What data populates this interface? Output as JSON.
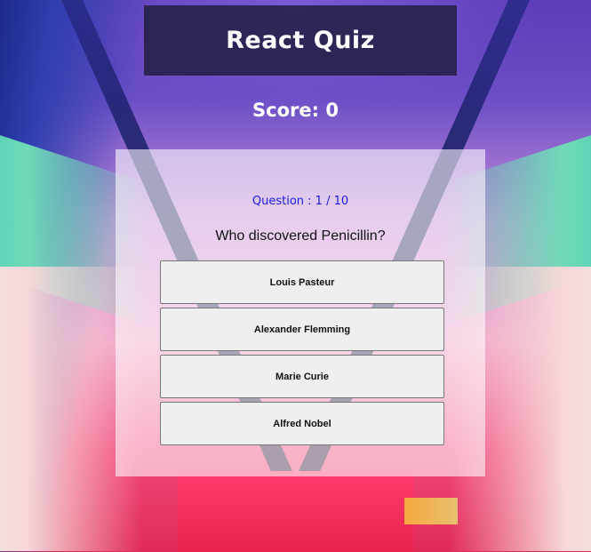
{
  "header": {
    "title": "React Quiz"
  },
  "score": {
    "label": "Score: 0"
  },
  "quiz": {
    "counter": "Question : 1 / 10",
    "question": "Who discovered Penicillin?",
    "answers": [
      {
        "label": "Louis Pasteur"
      },
      {
        "label": "Alexander Flemming"
      },
      {
        "label": "Marie Curie"
      },
      {
        "label": "Alfred Nobel"
      }
    ]
  },
  "colors": {
    "counter_text": "#1a1ae0",
    "title_bg": "#1e1c3c",
    "button_bg": "#efefef"
  }
}
